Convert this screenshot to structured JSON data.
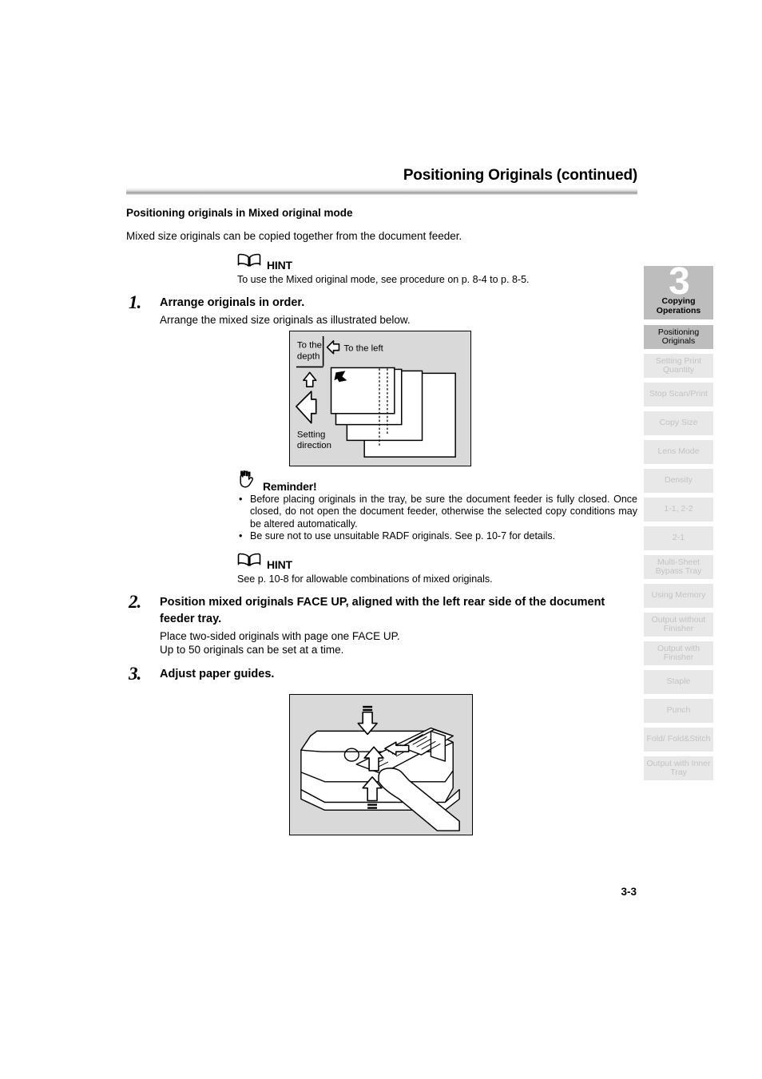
{
  "header": {
    "title": "Positioning Originals (continued)"
  },
  "section": {
    "heading": "Positioning originals in Mixed original mode",
    "intro": "Mixed size originals can be copied together from the document feeder."
  },
  "hint1": {
    "icon": "open-book-icon",
    "label": "HINT",
    "text": "To use the Mixed original mode, see procedure on p. 8-4 to p. 8-5."
  },
  "step1": {
    "number": "1.",
    "title": "Arrange originals in order.",
    "sub": "Arrange the mixed size originals as illustrated below."
  },
  "figure_arrange": {
    "name": "arrange-originals-diagram",
    "label_depth": "To the depth",
    "label_left": "To the left",
    "label_setting": "Setting direction",
    "arrow_up_icon": "outline-up-arrow-icon",
    "arrow_left_big_icon": "outline-left-arrow-icon",
    "arrow_left_small_icon": "outline-left-arrow-small-icon",
    "corner_mark_icon": "page-corner-mark-icon",
    "bg_color": "#d9d9d9"
  },
  "reminder": {
    "icon": "open-hand-icon",
    "label": "Reminder!",
    "items": [
      "Before placing originals in the tray, be sure the document feeder is fully closed. Once closed, do not open the document feeder, otherwise the selected copy conditions may be altered automatically.",
      "Be sure not to use unsuitable RADF originals. See p. 10-7 for details."
    ],
    "bullet": "•"
  },
  "hint2": {
    "icon": "open-book-icon",
    "label": "HINT",
    "text": "See p. 10-8 for allowable combinations of mixed originals."
  },
  "step2": {
    "number": "2.",
    "title": "Position mixed originals FACE UP, aligned with the left rear side of the document feeder tray.",
    "sub_line1": "Place two-sided originals with page one FACE UP.",
    "sub_line2": "Up to 50 originals can be set at a time."
  },
  "step3": {
    "number": "3.",
    "title": "Adjust paper guides."
  },
  "figure_guides": {
    "name": "adjust-paper-guides-illustration",
    "description": "document-feeder-with-hand-adjusting-guides",
    "bg_color": "#d9d9d9"
  },
  "siderail": {
    "chapter_number": "3",
    "chapter_name": "Copying Operations",
    "tabs": [
      {
        "label": "Positioning Originals",
        "active": true
      },
      {
        "label": "Setting Print Quantity",
        "active": false
      },
      {
        "label": "Stop Scan/Print",
        "active": false
      },
      {
        "label": "Copy Size",
        "active": false
      },
      {
        "label": "Lens Mode",
        "active": false
      },
      {
        "label": "Density",
        "active": false
      },
      {
        "label": "1-1, 2-2",
        "active": false
      },
      {
        "label": "2-1",
        "active": false
      },
      {
        "label": "Multi-Sheet Bypass Tray",
        "active": false
      },
      {
        "label": "Using Memory",
        "active": false
      },
      {
        "label": "Output without Finisher",
        "active": false
      },
      {
        "label": "Output with Finisher",
        "active": false
      },
      {
        "label": "Staple",
        "active": false
      },
      {
        "label": "Punch",
        "active": false
      },
      {
        "label": "Fold/ Fold&Stitch",
        "active": false
      },
      {
        "label": "Output with Inner Tray",
        "active": false
      }
    ],
    "active_bg": "#bdbdbd",
    "inactive_bg": "#e8e8e8",
    "inactive_text": "#c3c3c3"
  },
  "footer": {
    "page_number": "3-3"
  }
}
